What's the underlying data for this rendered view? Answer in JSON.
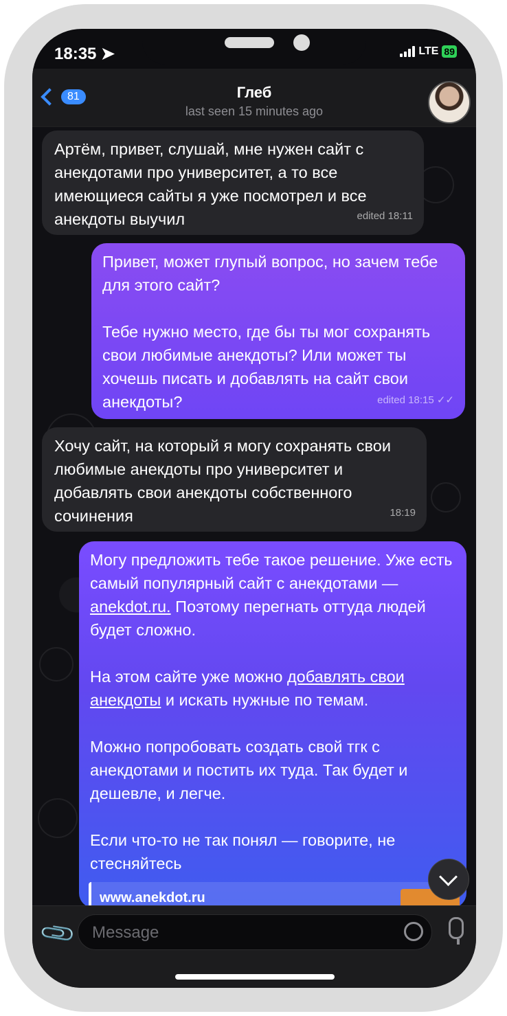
{
  "status": {
    "time": "18:35",
    "network": "LTE",
    "battery": "89"
  },
  "header": {
    "back_count": "81",
    "contact_name": "Глеб",
    "last_seen": "last seen 15 minutes ago"
  },
  "messages": [
    {
      "direction": "incoming",
      "paragraphs": [
        "Артём, привет, слушай, мне нужен сайт с анекдотами про университет, а то все имеющиеся сайты я уже посмотрел и все анекдоты выучил"
      ],
      "meta": "edited 18:11"
    },
    {
      "direction": "outgoing",
      "paragraphs": [
        "Привет, может глупый вопрос, но зачем тебе для этого сайт?",
        "Тебе нужно место, где бы ты мог сохранять свои любимые анекдоты? Или может ты хочешь писать и добавлять на сайт свои анекдоты?"
      ],
      "meta": "edited 18:15"
    },
    {
      "direction": "incoming",
      "paragraphs": [
        "Хочу сайт, на который я могу сохранять свои любимые анекдоты про университет и добавлять свои анекдоты собственного сочинения"
      ],
      "meta": "18:19"
    },
    {
      "direction": "outgoing",
      "p1_before": "Могу предложить тебе такое решение. Уже есть самый популярный сайт с анекдотами — ",
      "p1_link": "anekdot.ru.",
      "p1_after": " Поэтому перегнать оттуда людей будет сложно.",
      "p2_before": "На этом сайте уже можно ",
      "p2_link": "добавлять свои анекдоты",
      "p2_after": " и искать нужные по темам.",
      "p3": "Можно попробовать создать свой тгк с анекдотами и постить их туда. Так будет и дешевле, и легче.",
      "p4": "Если что-то не так понял — говорите, не стесняйтесь",
      "link_preview": "www.anekdot.ru"
    }
  ],
  "composer": {
    "placeholder": "Message"
  },
  "colors": {
    "accent": "#3a8cff",
    "incoming_bubble": "#26262a",
    "outgoing_top": "#8a4cf2",
    "outgoing_bottom": "#3f5cf0"
  }
}
